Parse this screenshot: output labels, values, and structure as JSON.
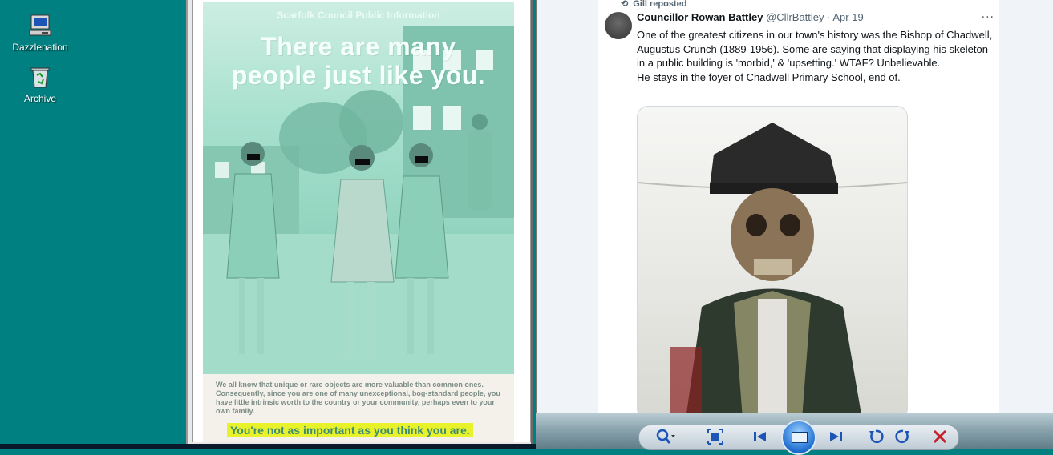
{
  "desktop": {
    "icons": [
      {
        "label": "Dazzlenation",
        "icon": "computer-icon"
      },
      {
        "label": "Archive",
        "icon": "recycle-bin-icon"
      }
    ]
  },
  "poster": {
    "header": "Scarfolk Council Public Information",
    "headline_line1": "There are many",
    "headline_line2": "people just like you.",
    "body": "We all know that unique or rare objects are more valuable than common ones. Consequently, since you are one of many unexceptional, bog-standard people, you have little intrinsic worth to the country or your community, perhaps even to your own family.",
    "highlight": "You're not as important as you think you are."
  },
  "tweet": {
    "reposted_by": "Gill reposted",
    "name": "Councillor Rowan Battley",
    "handle": "@CllrBattley",
    "date": "· Apr 19",
    "text_p1": "One of the greatest citizens in our town's history was the Bishop of Chadwell, Augustus Crunch (1889-1956). Some are saying that displaying his skeleton in a public building is 'morbid,' & 'upsetting.' WTAF? Unbelievable.",
    "text_p2": "He stays in the foyer of Chadwell Primary School, end of.",
    "more": "···"
  },
  "colors": {
    "desktop": "#008080",
    "poster_green": "#9cd8c5",
    "highlight": "#e8f22a",
    "link_blue": "#1c55b5"
  }
}
